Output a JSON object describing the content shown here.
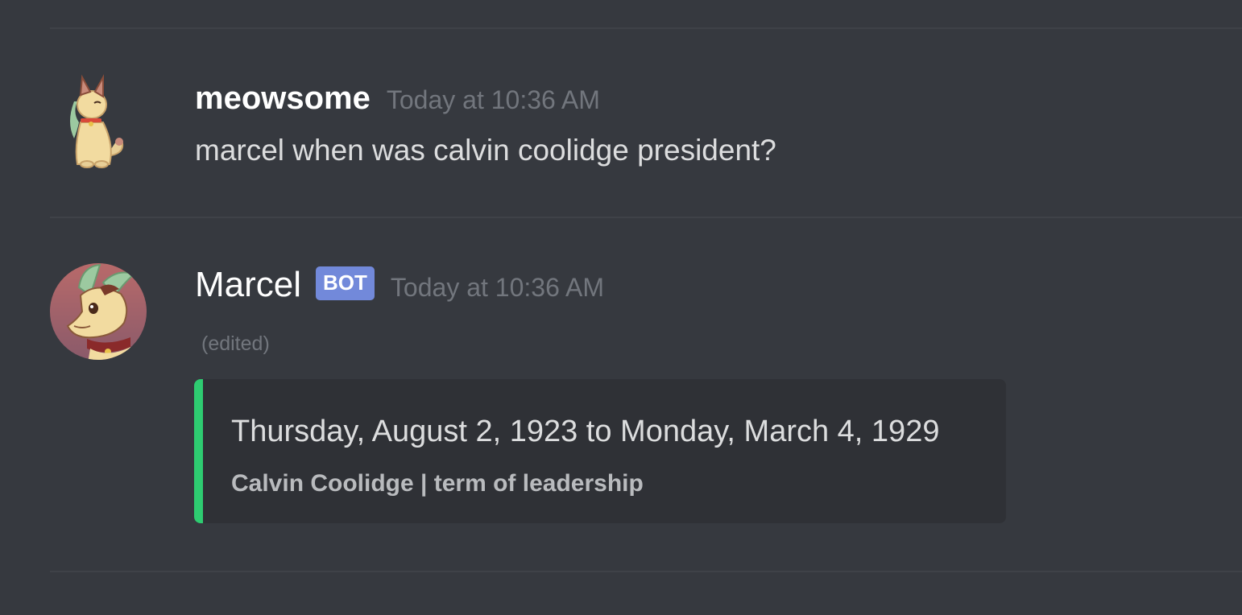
{
  "colors": {
    "background": "#36393f",
    "divider": "#3f4248",
    "username": "#ffffff",
    "timestamp": "#72767d",
    "message_text": "#dcddde",
    "bot_tag": "#7289da",
    "embed_background": "#2f3136",
    "embed_accent": "#2ecc71"
  },
  "messages": [
    {
      "author": "meowsome",
      "avatar_icon": "cat-avatar-icon",
      "timestamp": "Today at 10:36 AM",
      "content": "marcel when was calvin coolidge president?"
    },
    {
      "author": "Marcel",
      "avatar_icon": "bot-avatar-icon",
      "bot_tag": "BOT",
      "timestamp": "Today at 10:36 AM",
      "edited_label": "(edited)",
      "embed": {
        "title": "Thursday, August 2, 1923  to  Monday, March 4, 1929",
        "footer": "Calvin Coolidge | term of leadership"
      }
    }
  ]
}
